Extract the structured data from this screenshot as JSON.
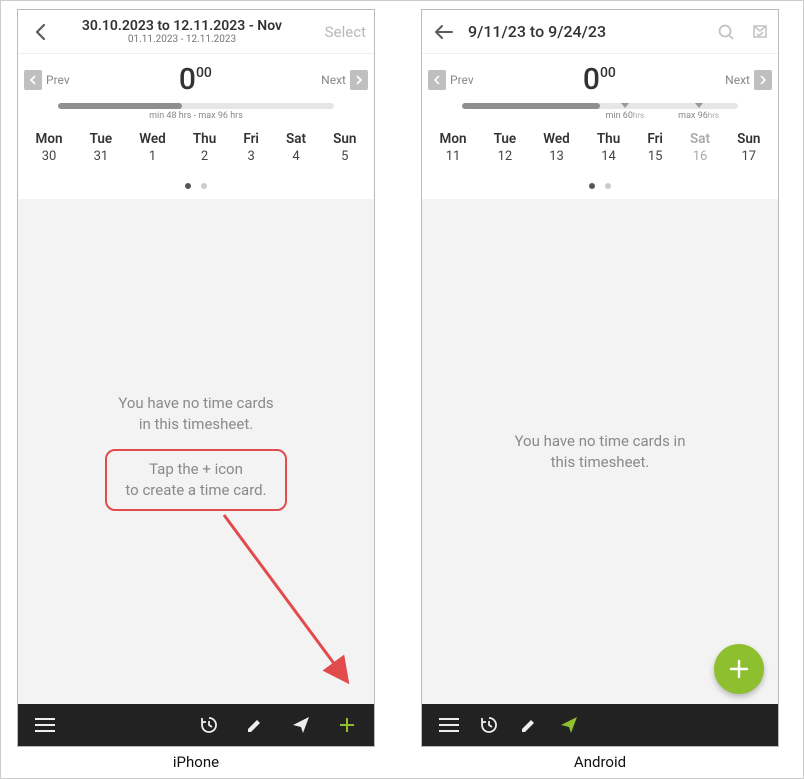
{
  "iphone": {
    "header": {
      "title_line1": "30.10.2023 to 12.11.2023 - Nov",
      "title_line2": "01.11.2023 - 12.11.2023",
      "select_label": "Select"
    },
    "nav": {
      "prev": "Prev",
      "next": "Next"
    },
    "hours": {
      "whole": "0",
      "dec": "00"
    },
    "range_label": "min 48 hrs - max 96 hrs",
    "days": [
      {
        "name": "Mon",
        "num": "30"
      },
      {
        "name": "Tue",
        "num": "31"
      },
      {
        "name": "Wed",
        "num": "1"
      },
      {
        "name": "Thu",
        "num": "2"
      },
      {
        "name": "Fri",
        "num": "3"
      },
      {
        "name": "Sat",
        "num": "4"
      },
      {
        "name": "Sun",
        "num": "5"
      }
    ],
    "empty": {
      "line1": "You have no time cards",
      "line2": "in this timesheet.",
      "hint1": "Tap the + icon",
      "hint2": "to create a time card."
    }
  },
  "android": {
    "header": {
      "title": "9/11/23 to 9/24/23"
    },
    "nav": {
      "prev": "Prev",
      "next": "Next"
    },
    "hours": {
      "whole": "0",
      "dec": "00"
    },
    "range": {
      "min_label": "min 60",
      "max_label": "max 96",
      "unit": "hrs"
    },
    "days": [
      {
        "name": "Mon",
        "num": "11",
        "dim": false
      },
      {
        "name": "Tue",
        "num": "12",
        "dim": false
      },
      {
        "name": "Wed",
        "num": "13",
        "dim": false
      },
      {
        "name": "Thu",
        "num": "14",
        "dim": false
      },
      {
        "name": "Fri",
        "num": "15",
        "dim": false
      },
      {
        "name": "Sat",
        "num": "16",
        "dim": true
      },
      {
        "name": "Sun",
        "num": "17",
        "dim": false
      }
    ],
    "empty": {
      "line1": "You have no time cards in",
      "line2": "this timesheet."
    }
  },
  "captions": {
    "iphone": "iPhone",
    "android": "Android"
  },
  "colors": {
    "accent_green": "#8dbf2f",
    "callout_red": "#e24b4b"
  }
}
